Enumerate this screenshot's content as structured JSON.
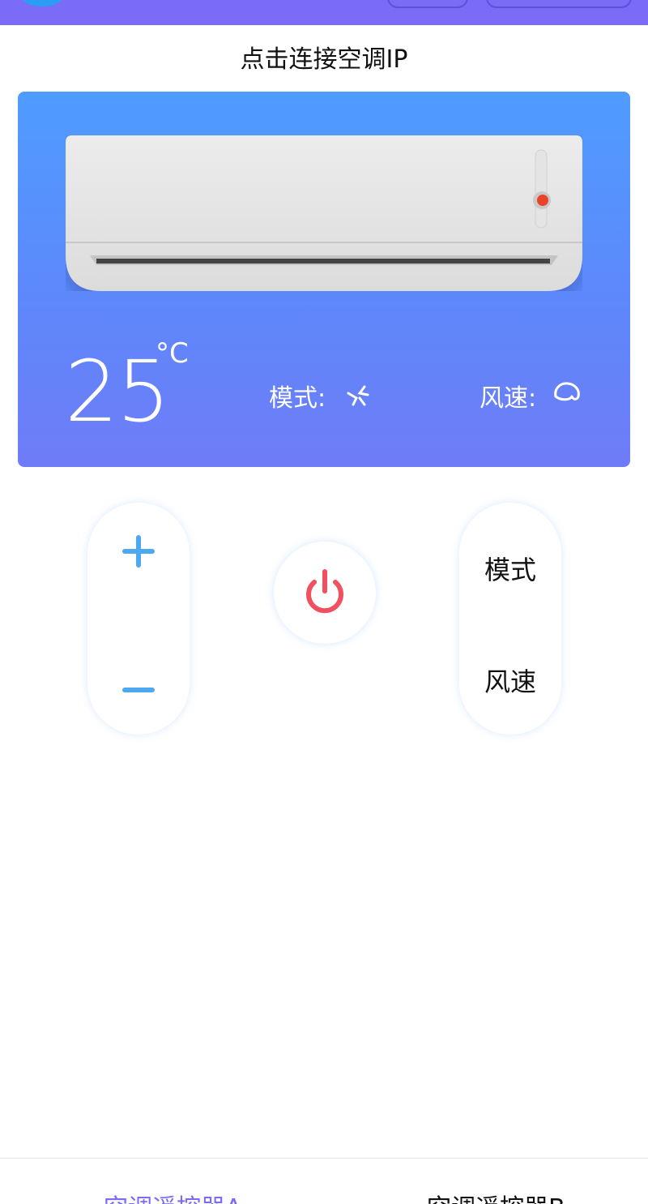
{
  "header": {
    "connect_label": "点击连接空调IP"
  },
  "display": {
    "temperature": "25",
    "unit": "°C",
    "mode_label": "模式:",
    "mode_icon": "fan-icon",
    "wind_label": "风速:",
    "wind_icon": "wind-icon"
  },
  "controls": {
    "plus_icon": "plus-icon",
    "minus_icon": "minus-icon",
    "power_icon": "power-icon",
    "mode_button": "模式",
    "wind_button": "风速"
  },
  "tabs": [
    {
      "label": "空调遥控器A",
      "active": true
    },
    {
      "label": "空调遥控器B",
      "active": false
    }
  ],
  "colors": {
    "accent": "#7a6cf7",
    "card_top": "#4f9cff",
    "card_bottom": "#6f7cf7",
    "plus_minus": "#4ea8ef",
    "power": "#f0505f"
  }
}
